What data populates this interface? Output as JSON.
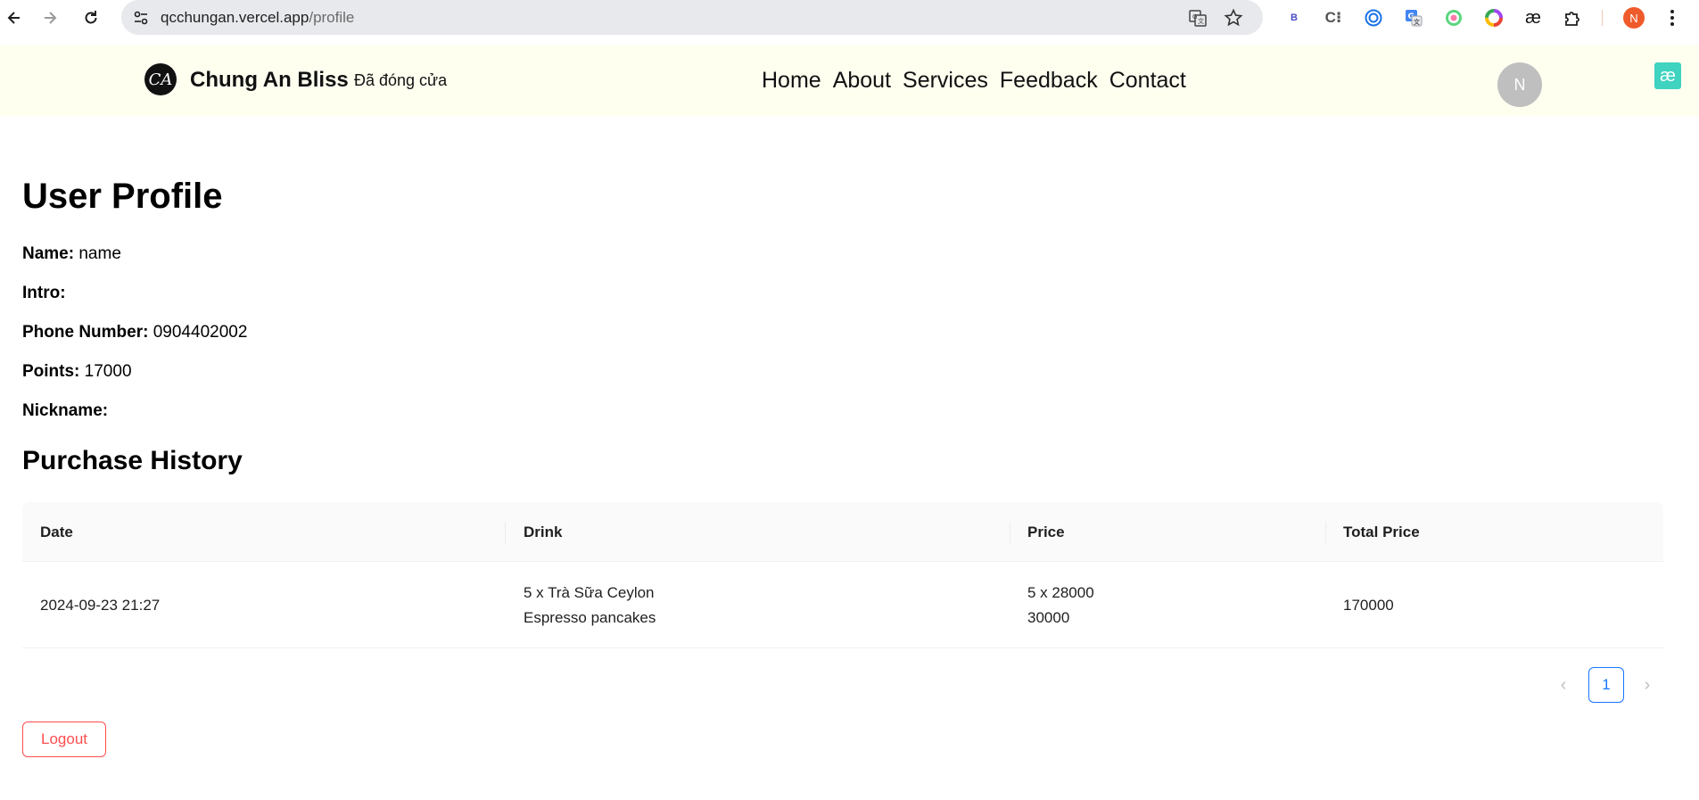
{
  "browser": {
    "url_host": "qcchungan.vercel.app",
    "url_path": "/profile",
    "extensions": [
      "B",
      "C⁝",
      "æ"
    ],
    "profile_initial": "N"
  },
  "header": {
    "logo_glyph": "CA",
    "brand": "Chung An Bliss",
    "status": "Đã đóng cửa",
    "nav": [
      "Home",
      "About",
      "Services",
      "Feedback",
      "Contact"
    ],
    "avatar_initial": "N",
    "badge": "æ"
  },
  "profile": {
    "title": "User Profile",
    "fields": [
      {
        "label": "Name:",
        "value": "name"
      },
      {
        "label": "Intro:",
        "value": ""
      },
      {
        "label": "Phone Number:",
        "value": "0904402002"
      },
      {
        "label": "Points:",
        "value": "17000"
      },
      {
        "label": "Nickname:",
        "value": ""
      }
    ]
  },
  "history": {
    "title": "Purchase History",
    "columns": [
      "Date",
      "Drink",
      "Price",
      "Total Price"
    ],
    "rows": [
      {
        "date": "2024-09-23 21:27",
        "drinks": [
          "5 x Trà Sữa Ceylon",
          "Espresso pancakes"
        ],
        "prices": [
          "5 x 28000",
          "30000"
        ],
        "total": "170000"
      }
    ],
    "pagination": {
      "current": "1",
      "prev": "‹",
      "next": "›"
    }
  },
  "actions": {
    "logout": "Logout"
  },
  "colors": {
    "header_bg": "#fffff0",
    "primary": "#1677ff",
    "danger": "#ff4d4f",
    "avatar": "#bfbfbf",
    "ae_badge": "#3fd3c0"
  }
}
